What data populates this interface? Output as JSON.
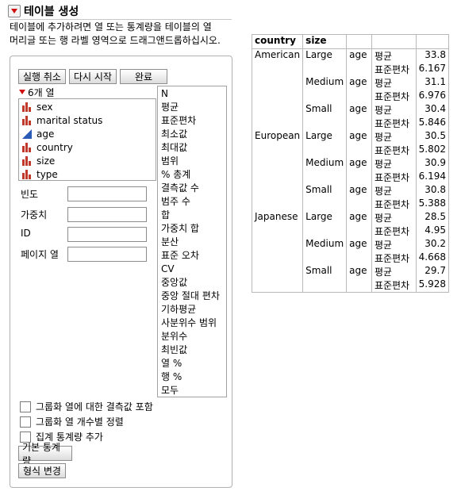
{
  "title": "테이블 생성",
  "instructions": [
    "테이블에 추가하려면 열 또는 통계량을 테이블의 열",
    "머리글 또는 행 라벨 영역으로 드래그앤드롭하십시오."
  ],
  "buttons": {
    "undo": "실행 취소",
    "restart": "다시 시작",
    "done": "완료"
  },
  "columns_header": "6개 열",
  "columns": [
    {
      "name": "sex",
      "icon": "nominal-bar-icon"
    },
    {
      "name": "marital status",
      "icon": "nominal-bar-icon"
    },
    {
      "name": "age",
      "icon": "continuous-triangle-icon"
    },
    {
      "name": "country",
      "icon": "nominal-bar-icon"
    },
    {
      "name": "size",
      "icon": "nominal-bar-icon"
    },
    {
      "name": "type",
      "icon": "nominal-bar-icon"
    }
  ],
  "statistics": [
    "N",
    "평균",
    "표준편차",
    "최소값",
    "최대값",
    "범위",
    "% 총계",
    "결측값 수",
    "범주 수",
    "합",
    "가중치 합",
    "분산",
    "표준 오차",
    "CV",
    "중앙값",
    "중앙 절대 편차",
    "기하평균",
    "사분위수 범위",
    "분위수",
    "최빈값",
    "열 %",
    "행 %",
    "모두"
  ],
  "roles": {
    "freq": "빈도",
    "weight": "가중치",
    "id": "ID",
    "page": "페이지 열"
  },
  "checkboxes": [
    "그룹화 열에 대한 결측값 포함",
    "그룹화 열 개수별 정렬",
    "집계 통계량 추가"
  ],
  "bottom_buttons": {
    "basic_stats": "기본 통계량",
    "change_format": "형식 변경"
  },
  "colors": {
    "red_triangle": "#d01010",
    "nominal_icon": "#c0392b",
    "continuous_icon": "#2a5bb5"
  },
  "table": {
    "headers": {
      "country": "country",
      "size": "size"
    },
    "var": "age",
    "stat_mean": "평균",
    "stat_sd": "표준편차",
    "rows": [
      {
        "country": "American",
        "size": "Large",
        "mean": "33.8",
        "sd": "6.167"
      },
      {
        "country": "",
        "size": "Medium",
        "mean": "31.1",
        "sd": "6.976"
      },
      {
        "country": "",
        "size": "Small",
        "mean": "30.4",
        "sd": "5.846"
      },
      {
        "country": "European",
        "size": "Large",
        "mean": "30.5",
        "sd": "5.802"
      },
      {
        "country": "",
        "size": "Medium",
        "mean": "30.9",
        "sd": "6.194"
      },
      {
        "country": "",
        "size": "Small",
        "mean": "30.8",
        "sd": "5.388"
      },
      {
        "country": "Japanese",
        "size": "Large",
        "mean": "28.5",
        "sd": "4.95"
      },
      {
        "country": "",
        "size": "Medium",
        "mean": "30.2",
        "sd": "4.668"
      },
      {
        "country": "",
        "size": "Small",
        "mean": "29.7",
        "sd": "5.928"
      }
    ]
  }
}
